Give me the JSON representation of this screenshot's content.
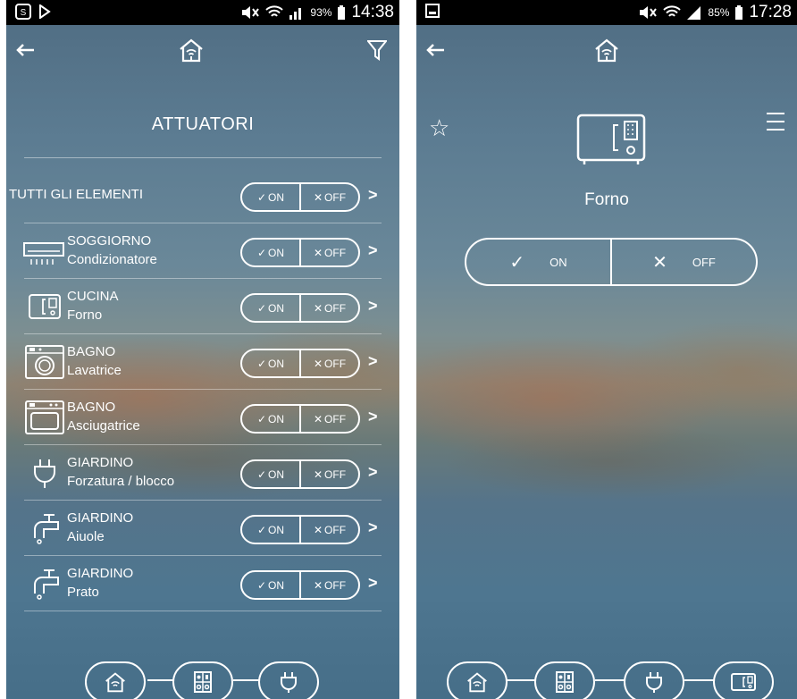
{
  "left": {
    "status": {
      "battery": "93%",
      "time": "14:38"
    },
    "title": "ATTUATORI",
    "all_label": "TUTTI GLI ELEMENTI",
    "on_label": "ON",
    "off_label": "OFF",
    "rows": [
      {
        "room": "SOGGIORNO",
        "device": "Condizionatore",
        "icon": "air-conditioner-icon"
      },
      {
        "room": "CUCINA",
        "device": "Forno",
        "icon": "oven-icon"
      },
      {
        "room": "BAGNO",
        "device": "Lavatrice",
        "icon": "washing-machine-icon"
      },
      {
        "room": "BAGNO",
        "device": "Asciugatrice",
        "icon": "dryer-icon"
      },
      {
        "room": "GIARDINO",
        "device": "Forzatura / blocco",
        "icon": "plug-icon"
      },
      {
        "room": "GIARDINO",
        "device": "Aiuole",
        "icon": "faucet-icon"
      },
      {
        "room": "GIARDINO",
        "device": "Prato",
        "icon": "faucet-icon"
      }
    ],
    "nav": [
      "home-wifi-icon",
      "control-panel-icon",
      "plug-icon"
    ]
  },
  "right": {
    "status": {
      "battery": "85%",
      "time": "17:28"
    },
    "device_name": "Forno",
    "on_label": "ON",
    "off_label": "OFF",
    "nav": [
      "home-wifi-icon",
      "control-panel-icon",
      "plug-icon",
      "oven-icon"
    ]
  }
}
